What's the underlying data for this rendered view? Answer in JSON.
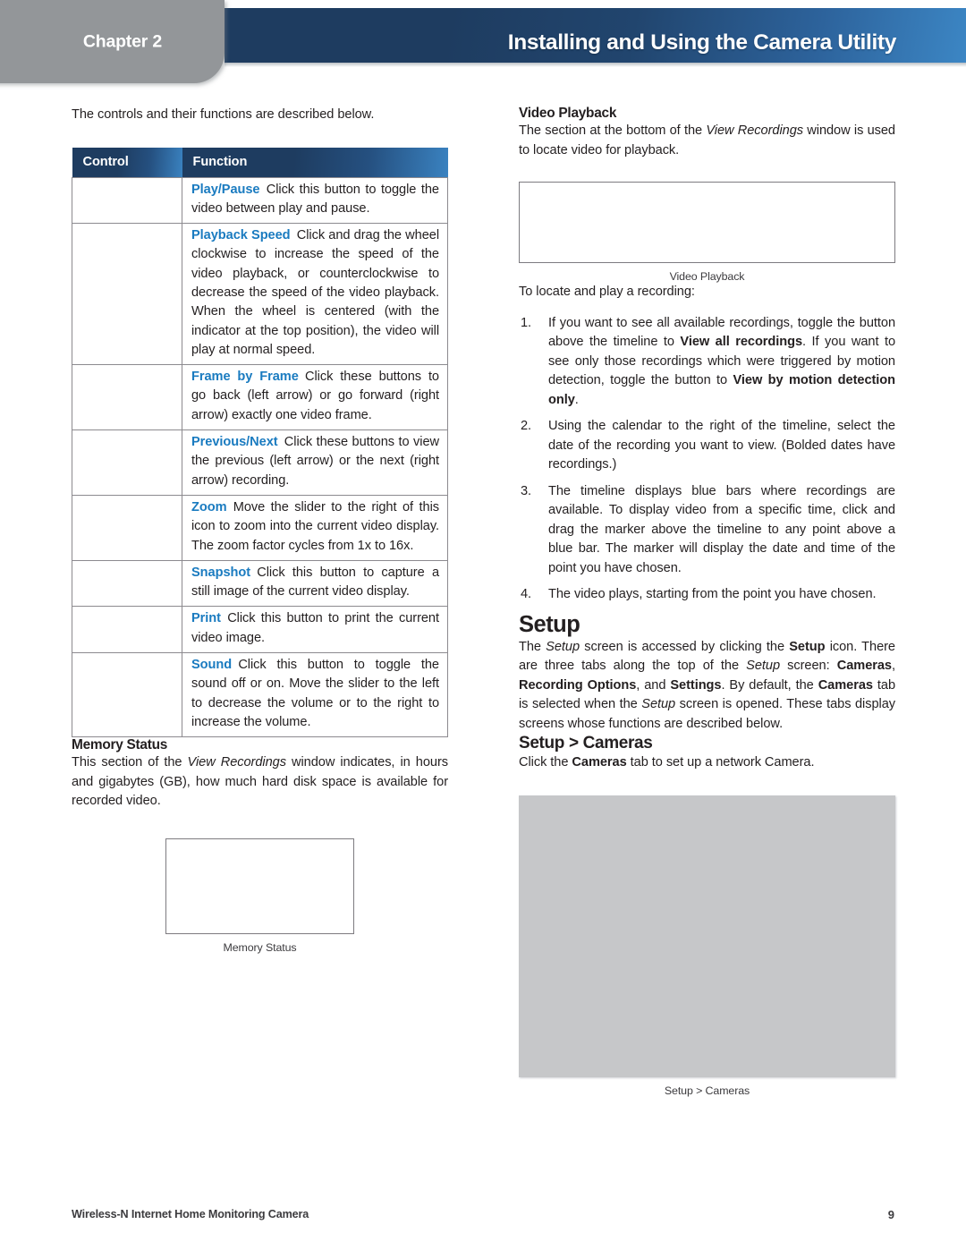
{
  "header": {
    "chapter_label": "Chapter 2",
    "title": "Installing and Using the Camera Utility",
    "gray_tab_color": "#939699",
    "band_color_dark": "#1e3c60",
    "band_color_light": "#3c86c4"
  },
  "left_column": {
    "intro": "The controls and their functions are described below.",
    "table": {
      "columns": [
        "Control",
        "Function"
      ],
      "rows": [
        {
          "control": "",
          "term": "Play/Pause",
          "description": "Click this button to toggle the video between play and pause."
        },
        {
          "control": "",
          "term": "Playback Speed",
          "description": "Click and drag the wheel clockwise to increase the speed of the video playback, or counterclockwise to decrease the speed of the video playback. When the wheel is centered (with the indicator at the top position), the video will play at normal speed."
        },
        {
          "control": "",
          "term": "Frame by Frame",
          "description": "Click these buttons to go back (left arrow) or go forward (right arrow) exactly one video frame."
        },
        {
          "control": "",
          "term": "Previous/Next",
          "description": "Click these buttons to view the previous (left arrow) or the next (right arrow) recording."
        },
        {
          "control": "",
          "term": "Zoom",
          "description": "Move the slider to the right of this icon to zoom into the current video display. The zoom factor cycles from 1x to 16x."
        },
        {
          "control": "",
          "term": "Snapshot",
          "description": "Click this button to capture a still image of the current video display."
        },
        {
          "control": "",
          "term": "Print",
          "description": "Click this button to print the current video image."
        },
        {
          "control": "",
          "term": "Sound",
          "description": "Click this button to toggle the sound off or on. Move the slider to the left to decrease the volume or to the right to increase the volume."
        }
      ]
    },
    "memory_status": {
      "heading": "Memory Status",
      "paragraph_part1": "This section of the ",
      "paragraph_italic": "View Recordings",
      "paragraph_part2": " window indicates, in hours and gigabytes (GB), how much hard disk space is available for recorded video.",
      "figure_caption": "Memory Status"
    }
  },
  "right_column": {
    "video_playback": {
      "heading": "Video Playback",
      "paragraph_part1": "The section at the bottom of the ",
      "paragraph_italic": "View Recordings",
      "paragraph_part2": " window is used to locate video for playback.",
      "figure_caption": "Video Playback",
      "steps_intro": "To locate and play a recording:",
      "steps": [
        {
          "num": "1.",
          "segments": [
            {
              "text": "If you want to see all available recordings, toggle the button above the timeline to ",
              "style": "normal"
            },
            {
              "text": "View all recordings",
              "style": "bold"
            },
            {
              "text": ". If you want to see only those recordings which were triggered by motion detection, toggle the button to ",
              "style": "normal"
            },
            {
              "text": "View by motion detection only",
              "style": "bold"
            },
            {
              "text": ".",
              "style": "normal"
            }
          ]
        },
        {
          "num": "2.",
          "segments": [
            {
              "text": "Using the calendar to the right of the timeline, select the date of the recording you want to view. (Bolded dates have recordings.)",
              "style": "normal"
            }
          ]
        },
        {
          "num": "3.",
          "segments": [
            {
              "text": "The timeline displays blue bars where recordings are available. To display video from a specific time, click and drag the marker above the timeline to any point above a blue bar. The marker will display the date and time of the point you have chosen.",
              "style": "normal"
            }
          ]
        },
        {
          "num": "4.",
          "segments": [
            {
              "text": "The video plays, starting from the point you have chosen.",
              "style": "normal"
            }
          ]
        }
      ]
    },
    "setup": {
      "heading": "Setup",
      "paragraph_segments": [
        {
          "text": "The ",
          "style": "normal"
        },
        {
          "text": "Setup",
          "style": "italic"
        },
        {
          "text": " screen is accessed by clicking the ",
          "style": "normal"
        },
        {
          "text": "Setup",
          "style": "bold"
        },
        {
          "text": " icon. There are three tabs along the top of the ",
          "style": "normal"
        },
        {
          "text": "Setup",
          "style": "italic"
        },
        {
          "text": " screen: ",
          "style": "normal"
        },
        {
          "text": "Cameras",
          "style": "bold"
        },
        {
          "text": ", ",
          "style": "normal"
        },
        {
          "text": "Recording Options",
          "style": "bold"
        },
        {
          "text": ", and ",
          "style": "normal"
        },
        {
          "text": "Settings",
          "style": "bold"
        },
        {
          "text": ". By default, the ",
          "style": "normal"
        },
        {
          "text": "Cameras",
          "style": "bold"
        },
        {
          "text": " tab is selected when the ",
          "style": "normal"
        },
        {
          "text": "Setup",
          "style": "italic"
        },
        {
          "text": " screen is opened. These tabs display screens whose functions are described below.",
          "style": "normal"
        }
      ]
    },
    "setup_cameras": {
      "heading": "Setup > Cameras",
      "paragraph_segments": [
        {
          "text": "Click the ",
          "style": "normal"
        },
        {
          "text": "Cameras",
          "style": "bold"
        },
        {
          "text": " tab to set up a network Camera.",
          "style": "normal"
        }
      ],
      "figure_caption": "Setup > Cameras",
      "figure_fill_color": "#c6c7c9"
    }
  },
  "footer": {
    "product_name": "Wireless-N Internet Home Monitoring Camera",
    "page_number": "9"
  }
}
